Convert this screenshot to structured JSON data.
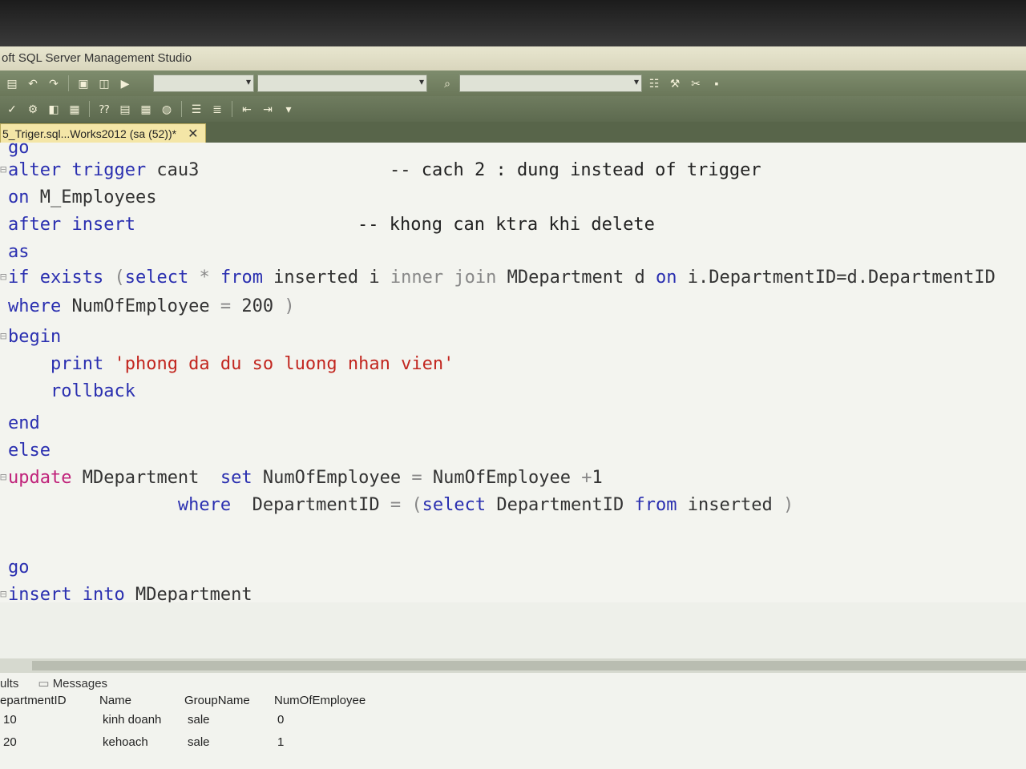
{
  "window": {
    "title": "oft SQL Server Management Studio"
  },
  "tab": {
    "label": "5_Triger.sql...Works2012 (sa (52))*",
    "close": "✕"
  },
  "editor": {
    "lines": [
      {
        "gutter": "",
        "parts": [
          {
            "t": "go",
            "c": "kw"
          }
        ]
      },
      {
        "gutter": "⊟",
        "parts": [
          {
            "t": "alter trigger",
            "c": "kw"
          },
          {
            "t": " cau3",
            "c": ""
          }
        ]
      },
      {
        "gutter": "",
        "parts": [
          {
            "t": "on",
            "c": "kw"
          },
          {
            "t": " M_Employees",
            "c": ""
          }
        ]
      },
      {
        "gutter": "",
        "parts": [
          {
            "t": "after insert",
            "c": "kw"
          }
        ]
      },
      {
        "gutter": "",
        "parts": [
          {
            "t": "as",
            "c": "kw"
          }
        ]
      },
      {
        "gutter": "⊟",
        "parts": [
          {
            "t": "if exists",
            "c": "kw"
          },
          {
            "t": " (",
            "c": "op"
          },
          {
            "t": "select",
            "c": "kw"
          },
          {
            "t": " * ",
            "c": "op"
          },
          {
            "t": "from",
            "c": "kw"
          },
          {
            "t": " inserted i ",
            "c": ""
          },
          {
            "t": "inner join",
            "c": "op"
          },
          {
            "t": " MDepartment d ",
            "c": ""
          },
          {
            "t": "on",
            "c": "kw"
          },
          {
            "t": " i.DepartmentID=d.DepartmentID",
            "c": ""
          }
        ]
      },
      {
        "gutter": "",
        "parts": [
          {
            "t": "where",
            "c": "kw"
          },
          {
            "t": " NumOfEmployee ",
            "c": ""
          },
          {
            "t": "=",
            "c": "op"
          },
          {
            "t": " 200 ",
            "c": ""
          },
          {
            "t": ")",
            "c": "op"
          }
        ]
      },
      {
        "gutter": "⊟",
        "parts": [
          {
            "t": "begin",
            "c": "kw"
          }
        ]
      },
      {
        "gutter": "",
        "parts": [
          {
            "t": "    print",
            "c": "kw"
          },
          {
            "t": " 'phong da du so luong nhan vien'",
            "c": "str"
          }
        ]
      },
      {
        "gutter": "",
        "parts": [
          {
            "t": "    rollback",
            "c": "kw"
          }
        ]
      },
      {
        "gutter": "",
        "parts": [
          {
            "t": "end",
            "c": "kw"
          }
        ]
      },
      {
        "gutter": "",
        "parts": [
          {
            "t": "else",
            "c": "kw"
          }
        ]
      },
      {
        "gutter": "⊟",
        "parts": [
          {
            "t": "update",
            "c": "kwp"
          },
          {
            "t": " MDepartment  ",
            "c": ""
          },
          {
            "t": "set",
            "c": "kw"
          },
          {
            "t": " NumOfEmployee ",
            "c": ""
          },
          {
            "t": "=",
            "c": "op"
          },
          {
            "t": " NumOfEmployee ",
            "c": ""
          },
          {
            "t": "+",
            "c": "op"
          },
          {
            "t": "1",
            "c": ""
          }
        ]
      },
      {
        "gutter": "",
        "parts": [
          {
            "t": "                where",
            "c": "kw"
          },
          {
            "t": "  DepartmentID ",
            "c": ""
          },
          {
            "t": "=",
            "c": "op"
          },
          {
            "t": " (",
            "c": "op"
          },
          {
            "t": "select",
            "c": "kw"
          },
          {
            "t": " DepartmentID ",
            "c": ""
          },
          {
            "t": "from",
            "c": "kw"
          },
          {
            "t": " inserted ",
            "c": ""
          },
          {
            "t": ")",
            "c": "op"
          }
        ]
      },
      {
        "gutter": "",
        "parts": []
      },
      {
        "gutter": "",
        "parts": [
          {
            "t": "go",
            "c": "kw"
          }
        ]
      },
      {
        "gutter": "⊟",
        "parts": [
          {
            "t": "insert into",
            "c": "kw"
          },
          {
            "t": " MDepartment",
            "c": ""
          }
        ]
      }
    ],
    "comments": [
      {
        "text": "-- cach 2 : dung instead of trigger"
      },
      {
        "text": "-- khong can ktra khi delete"
      }
    ]
  },
  "results": {
    "tabs": [
      "ults",
      "Messages"
    ],
    "columns": [
      "epartmentID",
      "Name",
      "GroupName",
      "NumOfEmployee"
    ],
    "rows": [
      [
        "10",
        "kinh doanh",
        "sale",
        "0"
      ],
      [
        "20",
        "kehoach",
        "sale",
        "1"
      ]
    ]
  }
}
